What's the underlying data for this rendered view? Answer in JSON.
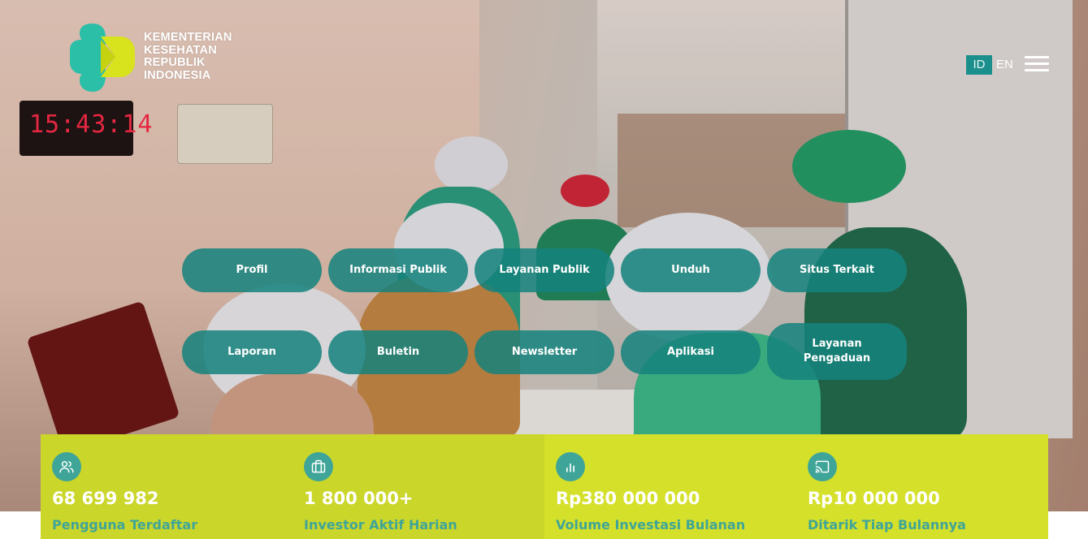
{
  "brand": {
    "logo_text": [
      "KEMENTERIAN",
      "KESEHATAN",
      "REPUBLIK",
      "INDONESIA"
    ],
    "logo_colors": {
      "teal": "#2bbfa7",
      "lime": "#d8e21d"
    }
  },
  "hero": {
    "clock_text": "15:43:14"
  },
  "language": {
    "id_label": "ID",
    "en_label": "EN",
    "active": "ID"
  },
  "menu": {
    "icon": "hamburger-icon"
  },
  "nav": {
    "row1": [
      "Profil",
      "Informasi Publik",
      "Layanan Publik",
      "Unduh",
      "Situs Terkait"
    ],
    "row2": [
      "Laporan",
      "Buletin",
      "Newsletter",
      "Aplikasi",
      "Layanan Pengaduan"
    ]
  },
  "stats": [
    {
      "icon": "users-icon",
      "value": "68 699 982",
      "label": "Pengguna Terdaftar"
    },
    {
      "icon": "briefcase-icon",
      "value": "1 800 000+",
      "label": "Investor Aktif Harian"
    },
    {
      "icon": "bar-chart-icon",
      "value": "Rp380 000 000",
      "label": "Volume Investasi Bulanan"
    },
    {
      "icon": "cast-icon",
      "value": "Rp10 000 000",
      "label": "Ditarik Tiap Bulannya"
    }
  ],
  "colors": {
    "pill": "#15827d",
    "stats_left": "#cbd62a",
    "stats_right": "#d4e02a",
    "accent_teal": "#3fa598",
    "lang_active_bg": "#1a8f8b"
  }
}
